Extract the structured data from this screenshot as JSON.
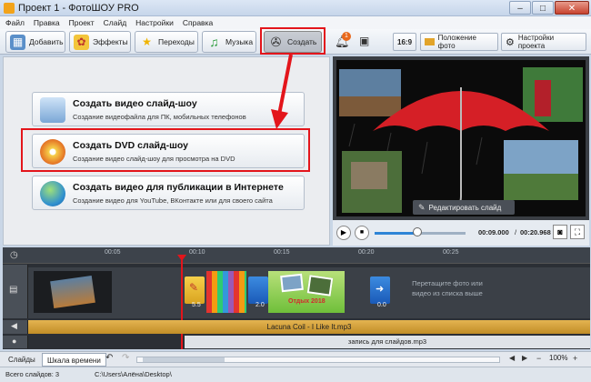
{
  "window": {
    "title": "Проект 1 - ФотоШОУ PRO",
    "controls": [
      "–",
      "□",
      "✕"
    ]
  },
  "menu": [
    "Файл",
    "Правка",
    "Проект",
    "Слайд",
    "Настройки",
    "Справка"
  ],
  "toolbar": {
    "tabs": [
      {
        "label": "Добавить",
        "icon": "add-photos-icon"
      },
      {
        "label": "Эффекты",
        "icon": "effects-icon"
      },
      {
        "label": "Переходы",
        "icon": "transitions-icon"
      },
      {
        "label": "Музыка",
        "icon": "music-icon"
      },
      {
        "label": "Создать",
        "icon": "film-reel-icon"
      }
    ],
    "notification_count": "1",
    "aspect": "16:9",
    "photo_position": "Положение фото",
    "project_settings": "Настройки проекта"
  },
  "create_options": [
    {
      "title": "Создать видео слайд-шоу",
      "subtitle": "Создание видеофайла для ПК, мобильных телефонов",
      "icon": "computer-phone-icon"
    },
    {
      "title": "Создать DVD слайд-шоу",
      "subtitle": "Создание видео слайд-шоу для просмотра на DVD",
      "icon": "dvd-disc-icon"
    },
    {
      "title": "Создать видео для публикации в Интернете",
      "subtitle": "Создание видео для YouTube, ВКонтакте или для своего сайта",
      "icon": "globe-icon"
    }
  ],
  "preview": {
    "edit_slide_label": "Редактировать слайд",
    "time_current": "00:09.000",
    "time_total": "00:20.968",
    "time_separator": "/"
  },
  "timeline": {
    "ticks": [
      "00:05",
      "00:10",
      "00:15",
      "00:20",
      "00:25"
    ],
    "transitions": [
      {
        "duration": "5.5"
      },
      {
        "duration": "2.0"
      },
      {
        "duration": "0.0"
      }
    ],
    "clip_caption": "Отдых 2018",
    "drop_hint": "Перетащите фото или видео из списка выше",
    "audio_track": "Lacuna Coil - I Like It.mp3",
    "voice_track": "запись для слайдов.mp3"
  },
  "bottom": {
    "tab_slides": "Слайды",
    "tab_timeline": "Шкала времени",
    "zoom": "100%"
  },
  "status": {
    "slides_count": "Всего слайдов: 3",
    "path": "C:\\Users\\Алёна\\Desktop\\"
  },
  "colors": {
    "accent_red": "#e3151b",
    "audio_gold": "#d4a13a",
    "timeline_bg": "#2b2f35"
  }
}
